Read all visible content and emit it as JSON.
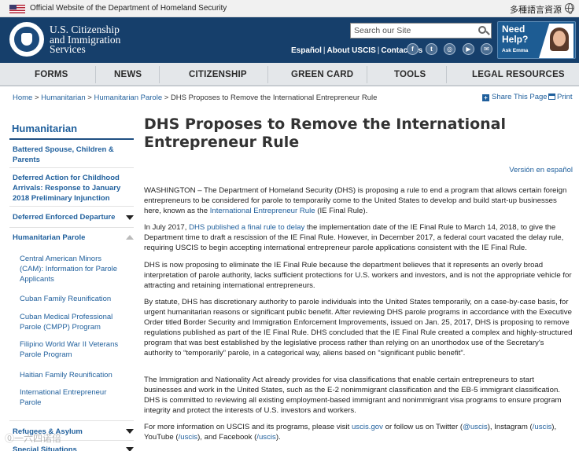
{
  "topbar": {
    "official_text": "Official Website of the Department of Homeland Security",
    "languages_text": "多種語言資源"
  },
  "header": {
    "brand_line1": "U.S. Citizenship",
    "brand_line2": "and Immigration",
    "brand_line3": "Services",
    "search_placeholder": "Search our Site",
    "links": [
      "Español",
      "About USCIS",
      "Contact Us"
    ],
    "need_help_line1": "Need",
    "need_help_line2": "Help?",
    "ask_emma": "Ask Emma"
  },
  "nav": {
    "items": [
      "FORMS",
      "NEWS",
      "CITIZENSHIP",
      "GREEN CARD",
      "TOOLS",
      "LEGAL RESOURCES"
    ]
  },
  "breadcrumb": {
    "items": [
      "Home",
      "Humanitarian",
      "Humanitarian Parole"
    ],
    "current": "DHS Proposes to Remove the International Entrepreneur Rule",
    "share_label": "Share This Page",
    "print_label": "Print"
  },
  "sidebar": {
    "title": "Humanitarian",
    "items": [
      {
        "line1": "Battered Spouse, Children &",
        "line2": "Parents"
      },
      {
        "line1": "Deferred Action for Childhood",
        "line2": "Arrivals: Response to January",
        "line3": "2018 Preliminary Injunction"
      },
      {
        "line1": "Deferred Enforced Departure"
      },
      {
        "line1": "Humanitarian Parole"
      }
    ],
    "subitems": [
      {
        "line1": "Central American Minors",
        "line2": "(CAM): Information for Parole",
        "line3": "Applicants"
      },
      {
        "line1": "Cuban Family Reunification"
      },
      {
        "line1": "Cuban Medical Professional",
        "line2": "Parole (CMPP) Program"
      },
      {
        "line1": "Filipino World War II Veterans",
        "line2": "Parole Program"
      },
      {
        "line1": "Haitian Family Reunification"
      },
      {
        "line1": "International Entrepreneur",
        "line2": "Parole"
      }
    ],
    "bottom_items": [
      "Refugees & Asylum",
      "Special Situations"
    ],
    "watermark": "⓪一六四诺倍"
  },
  "main": {
    "title": "DHS Proposes to Remove the International Entrepreneur Rule",
    "version_link": "Versión en español",
    "p1_a": "WASHINGTON – The Department of Homeland Security (DHS) is proposing a rule to end a program that allows certain foreign entrepreneurs to be considered for parole to temporarily come to the United States to develop and build start-up businesses here, known as the ",
    "p1_link": "International Entrepreneur Rule",
    "p1_b": " (IE Final Rule).",
    "p2_a": " In July 2017, ",
    "p2_link": "DHS published a final rule to delay",
    "p2_b": " the implementation date of the IE Final Rule to March 14, 2018, to give the Department time to draft a rescission of the IE Final Rule. However, in December 2017, a federal court vacated the delay rule, requiring USCIS to begin accepting international entrepreneur parole applications consistent with the IE Final Rule.",
    "p3": "DHS is now proposing to eliminate the IE Final Rule because the department believes that it represents an overly broad interpretation of parole authority, lacks sufficient protections for U.S. workers and investors, and is not the appropriate vehicle for attracting and retaining international entrepreneurs.",
    "p4": "By statute, DHS has discretionary authority to parole individuals into the United States temporarily, on a case-by-case basis, for urgent humanitarian reasons or significant public benefit. After reviewing DHS parole programs in accordance with the Executive Order titled Border Security and Immigration Enforcement Improvements, issued on Jan. 25, 2017, DHS is proposing to remove regulations published as part of the IE Final Rule. DHS concluded that the IE Final Rule created a complex and highly-structured program that was best established by the legislative process rather than relying on an unorthodox use of the Secretary's authority to “temporarily” parole, in a categorical way, aliens based on “significant public benefit”.",
    "p5": "The Immigration and Nationality Act already provides for visa classifications that enable certain entrepreneurs to start businesses and work in the United States, such as the E-2 nonimmigrant classification and the EB-5 immigrant classification. DHS is committed to reviewing all existing employment-based immigrant and nonimmigrant visa programs to ensure program integrity and protect the interests of U.S. investors and workers.",
    "p6_a": "For more information on USCIS and its programs, please visit ",
    "p6_link1": "uscis.gov",
    "p6_b": " or follow us on Twitter (",
    "p6_link2": "@uscis",
    "p6_c": "), Instagram (",
    "p6_link3": "/uscis",
    "p6_d": "), YouTube (",
    "p6_link4": "/uscis",
    "p6_e": "), and Facebook (",
    "p6_link5": "/uscis",
    "p6_f": ")."
  },
  "colors": {
    "header_bg": "#163f6b",
    "link": "#1f5f9c",
    "nav_bg": "#e4e7ea"
  }
}
